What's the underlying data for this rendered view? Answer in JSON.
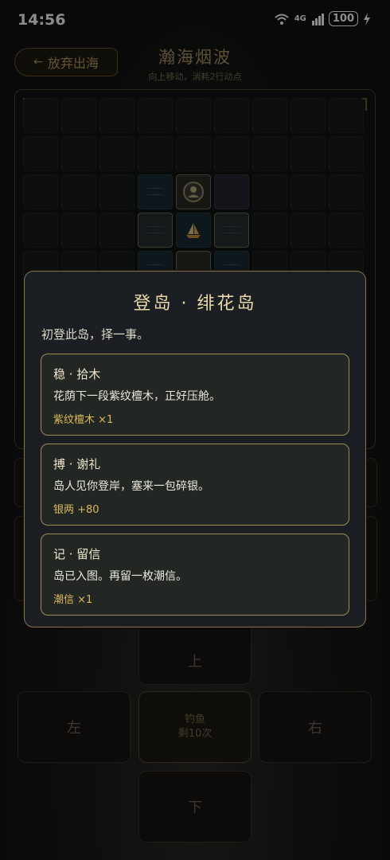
{
  "status_bar": {
    "time": "14:56",
    "signal_text": "4G",
    "battery": "100"
  },
  "header": {
    "abandon_button": "放弃出海",
    "title": "瀚海烟波",
    "subtitle": "向上移动，消耗2行动点"
  },
  "dialog": {
    "title": "登岛 · 绯花岛",
    "intro": "初登此岛，择一事。",
    "options": [
      {
        "title": "稳 · 拾木",
        "desc": "花荫下一段紫纹檀木，正好压舱。",
        "reward": "紫纹檀木 ×1"
      },
      {
        "title": "搏 · 谢礼",
        "desc": "岛人见你登岸，塞来一包碎银。",
        "reward": "银两 +80"
      },
      {
        "title": "记 · 留信",
        "desc": "岛已入图。再留一枚潮信。",
        "reward": "潮信 ×1"
      }
    ]
  },
  "controls": {
    "up": "上",
    "left": "左",
    "right": "右",
    "down": "下",
    "fish_label": "钓鱼",
    "fish_remaining": "剩10次"
  },
  "colors": {
    "accent_gold": "#a08a56",
    "reward_gold": "#d9b75f",
    "dialog_bg": "#1b1f24"
  }
}
